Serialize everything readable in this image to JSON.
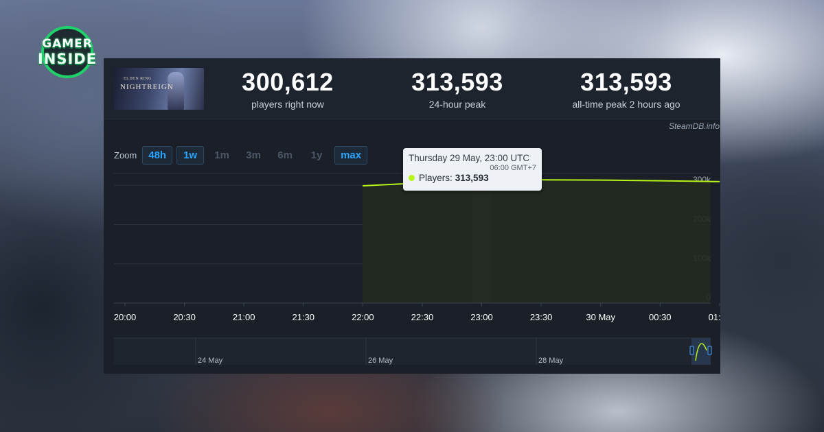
{
  "brand": {
    "line1": "GAMER",
    "line2": "INSIDE",
    "accent": "#1fd26a"
  },
  "game": {
    "subtitle": "ELDEN RING",
    "title": "NIGHTREIGN"
  },
  "stats": [
    {
      "value": "300,612",
      "label": "players right now"
    },
    {
      "value": "313,593",
      "label": "24-hour peak"
    },
    {
      "value": "313,593",
      "label": "all-time peak 2 hours ago"
    }
  ],
  "credit": "SteamDB.info",
  "zoom": {
    "label": "Zoom",
    "options": [
      {
        "label": "48h",
        "active": true
      },
      {
        "label": "1w",
        "active": true
      },
      {
        "label": "1m",
        "active": false
      },
      {
        "label": "3m",
        "active": false
      },
      {
        "label": "6m",
        "active": false
      },
      {
        "label": "1y",
        "active": false
      },
      {
        "label": "max",
        "active": true
      }
    ]
  },
  "tooltip": {
    "date": "Thursday 29 May, 23:00 UTC",
    "local": "06:00 GMT+7",
    "series_label": "Players:",
    "value": "313,593"
  },
  "chart_data": {
    "type": "area",
    "x_unit": "time (UTC)",
    "x": [
      "22:00",
      "23:00",
      "23:30",
      "00:00",
      "00:30",
      "01:00"
    ],
    "series": [
      {
        "name": "Players",
        "values": [
          298500,
          313593,
          313800,
          313200,
          311500,
          309200
        ]
      }
    ],
    "ylim": [
      0,
      330000
    ],
    "y_ticks": [
      {
        "value": 0,
        "label": "0"
      },
      {
        "value": 100000,
        "label": "100k"
      },
      {
        "value": 200000,
        "label": "200k"
      },
      {
        "value": 300000,
        "label": "300k"
      }
    ],
    "x_ticks": [
      "20:00",
      "20:30",
      "21:00",
      "21:30",
      "22:00",
      "22:30",
      "23:00",
      "23:30",
      "30 May",
      "00:30",
      "01:00"
    ],
    "highlight_index": 1,
    "navigator_labels": [
      "24 May",
      "26 May",
      "28 May"
    ],
    "colors": {
      "line": "#b7f418",
      "fill": "#232a20",
      "grid": "#2c3340",
      "axis_text": "#ffffff",
      "tick_text": "#9aa3ae"
    },
    "grid": true
  }
}
